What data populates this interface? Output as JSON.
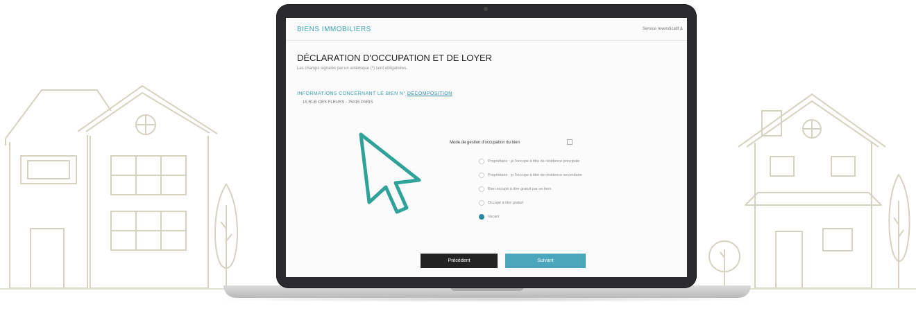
{
  "app": {
    "brand": "BIENS IMMOBILIERS",
    "nav_link": "Service revendicatif &"
  },
  "form": {
    "title": "DÉCLARATION D'OCCUPATION ET DE LOYER",
    "subtitle": "Les champs signalés par un astérisque (*) sont obligatoires.",
    "section_heading_prefix": "INFORMATIONS CONCERNANT LE BIEN N°",
    "section_heading_link": "DÉCOMPOSITION",
    "address": "15 RUE DES FLEURS - 75015 PARIS",
    "question_label": "Mode de gestion d'occupation du bien",
    "help_icon": "info-icon",
    "options": [
      {
        "label": "Propriétaire : je l'occupe à titre de résidence principale",
        "checked": false
      },
      {
        "label": "Propriétaire : je l'occupe à titre de résidence secondaire",
        "checked": false
      },
      {
        "label": "Bien occupé à titre gratuit par un tiers",
        "checked": false
      },
      {
        "label": "Occupé à titre gratuit",
        "checked": false
      },
      {
        "label": "Vacant",
        "checked": true
      }
    ],
    "prev_label": "Précédent",
    "next_label": "Suivant"
  },
  "colors": {
    "accent": "#4aa6bb",
    "dark_button": "#232323",
    "cursor": "#2fa39a",
    "house_lines": "#d6d2c2"
  }
}
